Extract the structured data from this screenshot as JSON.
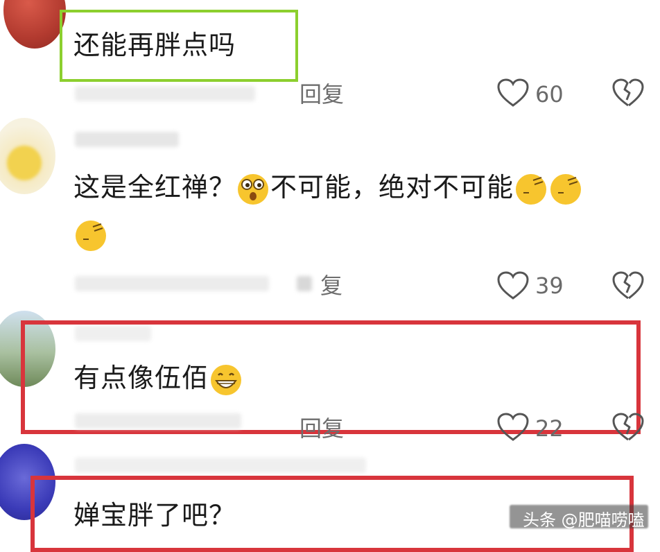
{
  "comments": [
    {
      "text": "还能再胖点吗",
      "reply_label": "回复",
      "likes": "60"
    },
    {
      "text_before": "这是全红禅？",
      "text_after": "不可能，绝对不可能",
      "reply_label": "复",
      "likes": "39"
    },
    {
      "text": "有点像伍佰",
      "reply_label": "回复",
      "likes": "22"
    },
    {
      "text": "婵宝胖了吧？"
    }
  ],
  "watermark": "头条 @肥喵唠嗑",
  "colors": {
    "green_frame": "#8ccf2e",
    "red_frame": "#d8353c",
    "emoji_yellow": "#f7c52e"
  },
  "icons": {
    "like": "heart-outline-icon",
    "dislike": "broken-heart-icon"
  }
}
